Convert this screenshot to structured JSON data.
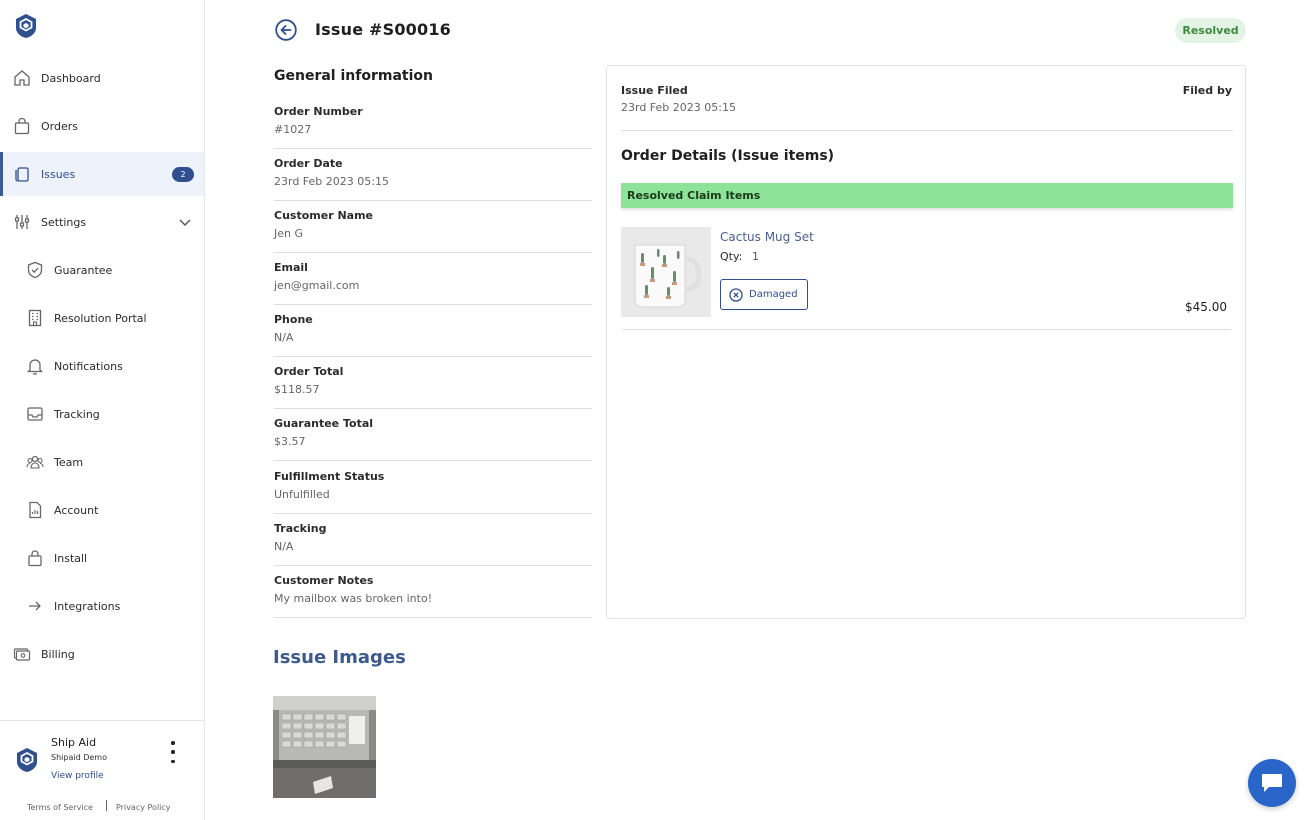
{
  "sidebar": {
    "items": [
      {
        "label": "Dashboard",
        "icon": "home-icon"
      },
      {
        "label": "Orders",
        "icon": "bag-icon"
      },
      {
        "label": "Issues",
        "icon": "issues-icon",
        "badge": "2"
      },
      {
        "label": "Settings",
        "icon": "sliders-icon"
      },
      {
        "label": "Guarantee",
        "icon": "shield-check-icon"
      },
      {
        "label": "Resolution Portal",
        "icon": "building-icon"
      },
      {
        "label": "Notifications",
        "icon": "bell-icon"
      },
      {
        "label": "Tracking",
        "icon": "inbox-icon"
      },
      {
        "label": "Team",
        "icon": "team-icon"
      },
      {
        "label": "Account",
        "icon": "document-icon"
      },
      {
        "label": "Install",
        "icon": "lock-bag-icon"
      },
      {
        "label": "Integrations",
        "icon": "arrow-right-icon"
      },
      {
        "label": "Billing",
        "icon": "billing-icon"
      }
    ],
    "account": {
      "name": "Ship Aid",
      "store": "Shipaid Demo",
      "profile_link": "View profile"
    },
    "legal": {
      "terms": "Terms of Service",
      "privacy": "Privacy Policy"
    }
  },
  "header": {
    "title": "Issue #S00016",
    "status": "Resolved"
  },
  "general_info": {
    "title": "General information",
    "rows": [
      {
        "label": "Order Number",
        "value": "#1027"
      },
      {
        "label": "Order Date",
        "value": "23rd Feb 2023 05:15"
      },
      {
        "label": "Customer Name",
        "value": "Jen G"
      },
      {
        "label": "Email",
        "value": "jen@gmail.com"
      },
      {
        "label": "Phone",
        "value": "N/A"
      },
      {
        "label": "Order Total",
        "value": "$118.57"
      },
      {
        "label": "Guarantee Total",
        "value": "$3.57"
      },
      {
        "label": "Fulfillment Status",
        "value": "Unfulfilled"
      },
      {
        "label": "Tracking",
        "value": "N/A"
      },
      {
        "label": "Customer Notes",
        "value": "My mailbox was broken into!"
      }
    ]
  },
  "issue_card": {
    "filed_label": "Issue Filed",
    "filed_value": "23rd Feb 2023 05:15",
    "filed_by_label": "Filed by",
    "details_title": "Order Details (Issue items)",
    "resolved_bar": "Resolved Claim Items",
    "item": {
      "name": "Cactus Mug Set",
      "qty_label": "Qty:",
      "qty_value": "1",
      "tag": "Damaged",
      "price": "$45.00"
    }
  },
  "issue_images": {
    "title": "Issue Images"
  },
  "colors": {
    "accent": "#2f4f8f",
    "resolved_bg": "#e4f4e4",
    "resolved_text": "#3f8a3f",
    "resolved_bar": "#8ee39a",
    "chat": "#2a66c9"
  }
}
